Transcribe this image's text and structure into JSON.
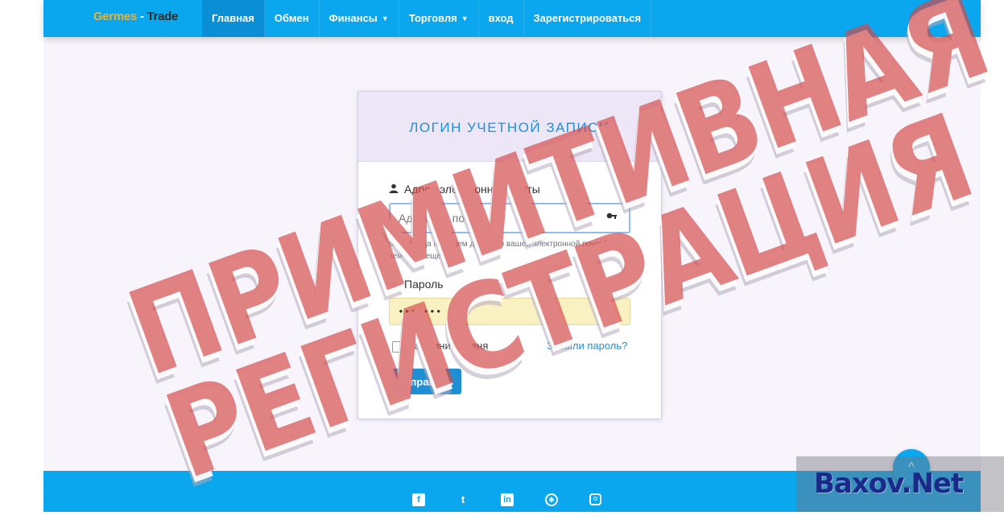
{
  "navbar": {
    "brand_part1": "Germes",
    "brand_sep": " - ",
    "brand_part2": "Trade",
    "links": [
      {
        "label": "Главная"
      },
      {
        "label": "Обмен"
      },
      {
        "label": "Финансы"
      },
      {
        "label": "Торговля"
      },
      {
        "label": "вход"
      },
      {
        "label": "Зарегистрироваться"
      }
    ],
    "dropdown_caret": "▼"
  },
  "login": {
    "title": "ЛОГИН УЧЕТНОЙ ЗАПИСИ",
    "email_label": "Адрес электронной почты",
    "email_placeholder": "Адрес эл. почты",
    "email_help": "мы никогда не будем делиться вашей электронной почтой с кем-либо еще",
    "password_label": "Пароль",
    "password_value": "•••••••",
    "remember_label": "Запомнить меня",
    "forgot_label": "Забыли пароль?",
    "submit_label": "Отправить"
  },
  "stamp": {
    "line1": "ПРИМИТИВНАЯ",
    "line2": "РЕГИСТРАЦИЯ"
  },
  "watermark": "Baxov.Net",
  "back_to_top": "^",
  "footer": {
    "social_icons": [
      "facebook-icon",
      "tumblr-icon",
      "linkedin-icon",
      "dribbble-icon",
      "instagram-icon"
    ]
  },
  "colors": {
    "primary": "#0aa6ee",
    "title_blue": "#1e90d8",
    "stamp_red": "#d44848",
    "card_header": "#ede6f7"
  }
}
